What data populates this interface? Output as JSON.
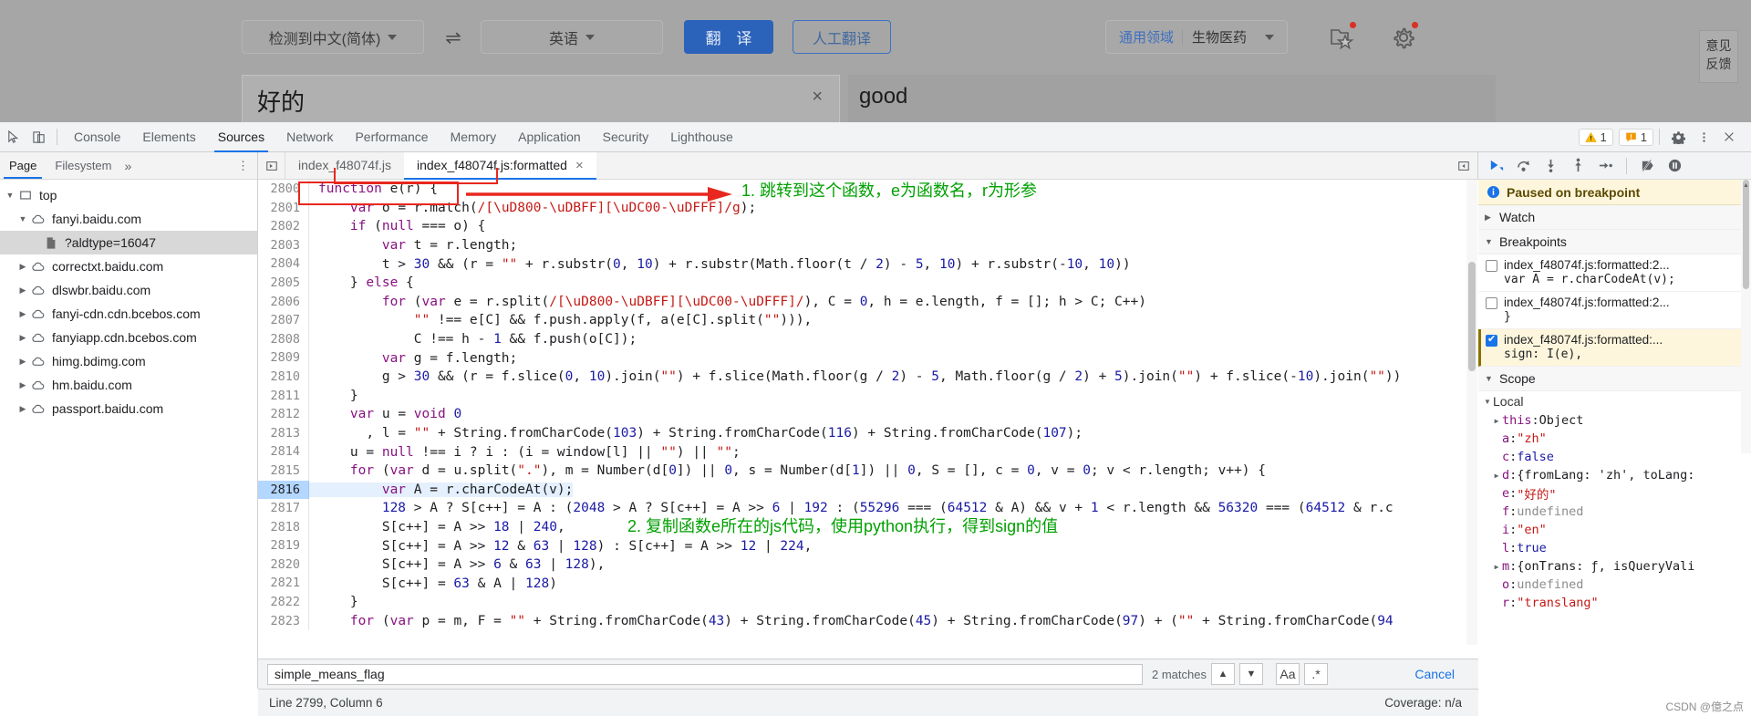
{
  "translate": {
    "source_lang": "检测到中文(简体)",
    "target_lang": "英语",
    "swap_icon": "swap-icon",
    "translate_button": "翻 译",
    "human_translate_button": "人工翻译",
    "domain_general": "通用领域",
    "domain_selected": "生物医药",
    "favorites_icon": "favorites-folder-icon",
    "settings_icon": "gear-icon",
    "feedback_button": "意见\n反馈",
    "feedback_line1": "意见",
    "feedback_line2": "反馈",
    "source_text": "好的",
    "clear_icon": "×",
    "target_text": "good"
  },
  "devtools": {
    "inspect_icon": "inspect-element-icon",
    "device_icon": "device-toolbar-icon",
    "tabs": [
      {
        "label": "Console",
        "active": false
      },
      {
        "label": "Elements",
        "active": false
      },
      {
        "label": "Sources",
        "active": true
      },
      {
        "label": "Network",
        "active": false
      },
      {
        "label": "Performance",
        "active": false
      },
      {
        "label": "Memory",
        "active": false
      },
      {
        "label": "Application",
        "active": false
      },
      {
        "label": "Security",
        "active": false
      },
      {
        "label": "Lighthouse",
        "active": false
      }
    ],
    "warning_count": "1",
    "issue_count": "1",
    "settings_icon": "gear-icon",
    "more_icon": "kebab-menu-icon",
    "close_icon": "close-icon"
  },
  "navigator": {
    "tabs": [
      {
        "label": "Page",
        "active": true
      },
      {
        "label": "Filesystem",
        "active": false
      }
    ],
    "overflow": "»",
    "kebab": "⋮",
    "tree": [
      {
        "label": "top",
        "indent": 0,
        "twisty": "▼",
        "icon": "frame-icon",
        "selected": false
      },
      {
        "label": "fanyi.baidu.com",
        "indent": 1,
        "twisty": "▼",
        "icon": "cloud-icon",
        "selected": false
      },
      {
        "label": "?aldtype=16047",
        "indent": 2,
        "twisty": "",
        "icon": "document-icon",
        "selected": true
      },
      {
        "label": "correctxt.baidu.com",
        "indent": 1,
        "twisty": "▶",
        "icon": "cloud-icon",
        "selected": false
      },
      {
        "label": "dlswbr.baidu.com",
        "indent": 1,
        "twisty": "▶",
        "icon": "cloud-icon",
        "selected": false
      },
      {
        "label": "fanyi-cdn.cdn.bcebos.com",
        "indent": 1,
        "twisty": "▶",
        "icon": "cloud-icon",
        "selected": false
      },
      {
        "label": "fanyiapp.cdn.bcebos.com",
        "indent": 1,
        "twisty": "▶",
        "icon": "cloud-icon",
        "selected": false
      },
      {
        "label": "himg.bdimg.com",
        "indent": 1,
        "twisty": "▶",
        "icon": "cloud-icon",
        "selected": false
      },
      {
        "label": "hm.baidu.com",
        "indent": 1,
        "twisty": "▶",
        "icon": "cloud-icon",
        "selected": false
      },
      {
        "label": "passport.baidu.com",
        "indent": 1,
        "twisty": "▶",
        "icon": "cloud-icon",
        "selected": false
      }
    ]
  },
  "editor": {
    "collapse_icon": "collapse-sidebar-icon",
    "expand_icon": "expand-icon",
    "tabs": [
      {
        "label": "index_f48074f.js",
        "active": false,
        "closable": false
      },
      {
        "label": "index_f48074f.js:formatted",
        "active": true,
        "closable": true
      }
    ],
    "close_icon": "×",
    "first_line": 2800,
    "highlight_line": 2816,
    "lines": [
      {
        "no": 2800,
        "text": "function e(r) {"
      },
      {
        "no": 2801,
        "text": "    var o = r.match(/[\\uD800-\\uDBFF][\\uDC00-\\uDFFF]/g);"
      },
      {
        "no": 2802,
        "text": "    if (null === o) {"
      },
      {
        "no": 2803,
        "text": "        var t = r.length;"
      },
      {
        "no": 2804,
        "text": "        t > 30 && (r = \"\" + r.substr(0, 10) + r.substr(Math.floor(t / 2) - 5, 10) + r.substr(-10, 10))"
      },
      {
        "no": 2805,
        "text": "    } else {"
      },
      {
        "no": 2806,
        "text": "        for (var e = r.split(/[\\uD800-\\uDBFF][\\uDC00-\\uDFFF]/), C = 0, h = e.length, f = []; h > C; C++)"
      },
      {
        "no": 2807,
        "text": "            \"\" !== e[C] && f.push.apply(f, a(e[C].split(\"\"))),"
      },
      {
        "no": 2808,
        "text": "            C !== h - 1 && f.push(o[C]);"
      },
      {
        "no": 2809,
        "text": "        var g = f.length;"
      },
      {
        "no": 2810,
        "text": "        g > 30 && (r = f.slice(0, 10).join(\"\") + f.slice(Math.floor(g / 2) - 5, Math.floor(g / 2) + 5).join(\"\") + f.slice(-10).join(\"\"))"
      },
      {
        "no": 2811,
        "text": "    }"
      },
      {
        "no": 2812,
        "text": "    var u = void 0"
      },
      {
        "no": 2813,
        "text": "      , l = \"\" + String.fromCharCode(103) + String.fromCharCode(116) + String.fromCharCode(107);"
      },
      {
        "no": 2814,
        "text": "    u = null !== i ? i : (i = window[l] || \"\") || \"\";"
      },
      {
        "no": 2815,
        "text": "    for (var d = u.split(\".\"), m = Number(d[0]) || 0, s = Number(d[1]) || 0, S = [], c = 0, v = 0; v < r.length; v++) {"
      },
      {
        "no": 2816,
        "text": "        var A = r.charCodeAt(v);"
      },
      {
        "no": 2817,
        "text": "        128 > A ? S[c++] = A : (2048 > A ? S[c++] = A >> 6 | 192 : (55296 === (64512 & A) && v + 1 < r.length && 56320 === (64512 & r.c"
      },
      {
        "no": 2818,
        "text": "        S[c++] = A >> 18 | 240,"
      },
      {
        "no": 2819,
        "text": "        S[c++] = A >> 12 & 63 | 128) : S[c++] = A >> 12 | 224,"
      },
      {
        "no": 2820,
        "text": "        S[c++] = A >> 6 & 63 | 128),"
      },
      {
        "no": 2821,
        "text": "        S[c++] = 63 & A | 128)"
      },
      {
        "no": 2822,
        "text": "    }"
      },
      {
        "no": 2823,
        "text": "    for (var p = m, F = \"\" + String.fromCharCode(43) + String.fromCharCode(45) + String.fromCharCode(97) + (\"\" + String.fromCharCode(94"
      }
    ]
  },
  "annotations": [
    {
      "text": "1. 跳转到这个函数，e为函数名，r为形参",
      "color": "#00a000"
    },
    {
      "text": "2. 复制函数e所在的js代码，使用python执行，得到sign的值",
      "color": "#00a000"
    }
  ],
  "search": {
    "value": "simple_means_flag",
    "matches": "2 matches",
    "prev_icon": "chevron-up-icon",
    "next_icon": "chevron-down-icon",
    "match_case_label": "Aa",
    "regex_label": ".*",
    "cancel_label": "Cancel"
  },
  "status": {
    "position": "Line 2799, Column 6",
    "coverage": "Coverage: n/a"
  },
  "debugger": {
    "controls": [
      {
        "name": "resume-script-execution",
        "icon": "play-icon"
      },
      {
        "name": "step-over-next-function-call",
        "icon": "step-over-icon"
      },
      {
        "name": "step-into-next-function-call",
        "icon": "step-into-icon"
      },
      {
        "name": "step-out-of-current-function",
        "icon": "step-out-icon"
      },
      {
        "name": "step",
        "icon": "step-icon"
      },
      {
        "name": "deactivate-breakpoints",
        "icon": "deactivate-breakpoints-icon"
      },
      {
        "name": "pause-on-exceptions",
        "icon": "pause-on-exceptions-icon"
      }
    ],
    "paused_banner": "Paused on breakpoint",
    "paused_icon": "info-icon",
    "watch_label": "Watch",
    "breakpoints_label": "Breakpoints",
    "breakpoints": [
      {
        "location": "index_f48074f.js:formatted:2...",
        "code": "var A = r.charCodeAt(v);",
        "checked": false,
        "active": false
      },
      {
        "location": "index_f48074f.js:formatted:2...",
        "code": "}",
        "checked": false,
        "active": false
      },
      {
        "location": "index_f48074f.js:formatted:...",
        "code": "sign: I(e),",
        "checked": true,
        "active": true
      }
    ],
    "scope_label": "Scope",
    "local_label": "Local",
    "scope_vars": [
      {
        "twisty": "▶",
        "name": "this",
        "sep": ": ",
        "value": "Object",
        "kind": "obj"
      },
      {
        "twisty": "",
        "name": "a",
        "sep": ": ",
        "value": "\"zh\"",
        "kind": "str"
      },
      {
        "twisty": "",
        "name": "c",
        "sep": ": ",
        "value": "false",
        "kind": "kw"
      },
      {
        "twisty": "▶",
        "name": "d",
        "sep": ": ",
        "value": "{fromLang: 'zh', toLang:",
        "kind": "obj"
      },
      {
        "twisty": "",
        "name": "e",
        "sep": ": ",
        "value": "\"好的\"",
        "kind": "str"
      },
      {
        "twisty": "",
        "name": "f",
        "sep": ": ",
        "value": "undefined",
        "kind": "und"
      },
      {
        "twisty": "",
        "name": "i",
        "sep": ": ",
        "value": "\"en\"",
        "kind": "str"
      },
      {
        "twisty": "",
        "name": "l",
        "sep": ": ",
        "value": "true",
        "kind": "kw"
      },
      {
        "twisty": "▶",
        "name": "m",
        "sep": ": ",
        "value": "{onTrans: ƒ, isQueryVali",
        "kind": "obj"
      },
      {
        "twisty": "",
        "name": "o",
        "sep": ": ",
        "value": "undefined",
        "kind": "und"
      },
      {
        "twisty": "",
        "name": "r",
        "sep": ": ",
        "value": "\"translang\"",
        "kind": "str"
      }
    ]
  },
  "watermark": "CSDN @億之点"
}
